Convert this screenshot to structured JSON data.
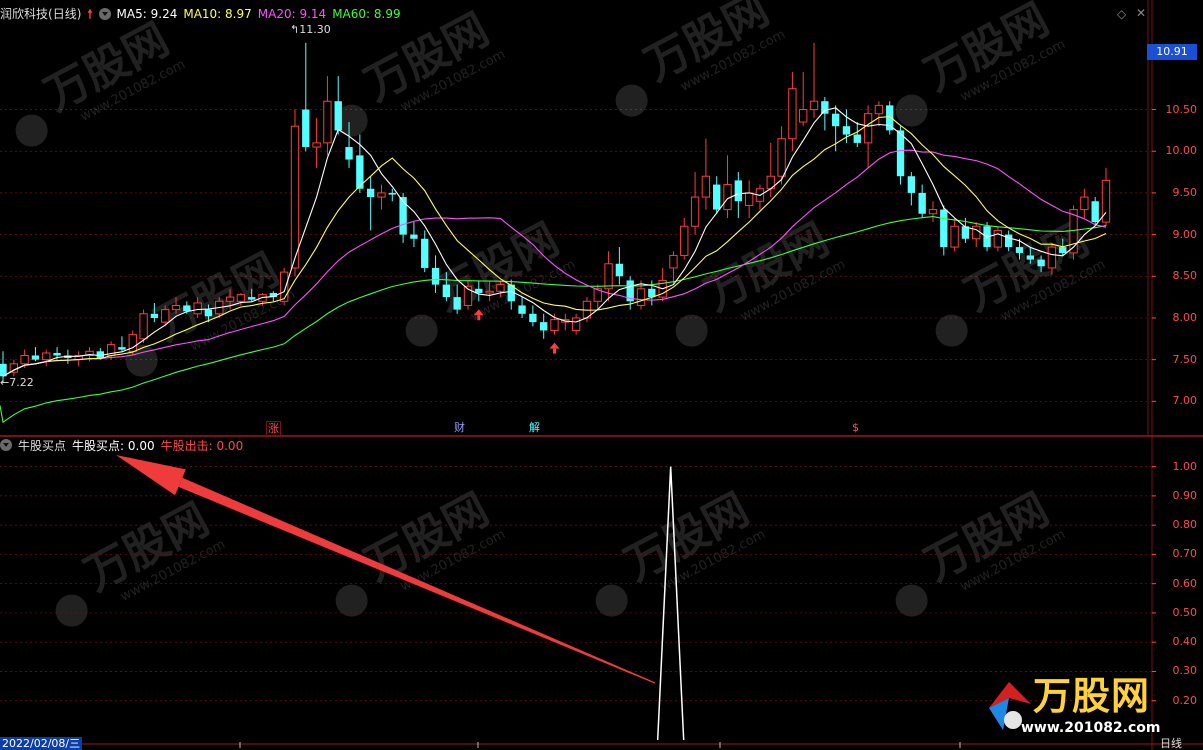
{
  "header": {
    "stock_name": "润欣科技",
    "period": "(日线)",
    "ma5_label": "MA5:",
    "ma5_value": "9.24",
    "ma10_label": "MA10:",
    "ma10_value": "8.97",
    "ma20_label": "MA20:",
    "ma20_value": "9.14",
    "ma60_label": "MA60:",
    "ma60_value": "8.99"
  },
  "colors": {
    "up": "#ff3b3b",
    "down": "#54ffff",
    "ma5": "#ffffff",
    "ma10": "#ffff4f",
    "ma20": "#ff4fff",
    "ma60": "#3cff3c",
    "grid": "#7a1010",
    "axis_text": "#ff4a4a"
  },
  "main_chart": {
    "high_label": "11.30",
    "low_label": "7.22",
    "current_price": "10.91",
    "y_ticks": [
      "10.50",
      "10.00",
      "9.50",
      "9.00",
      "8.50",
      "8.00",
      "7.50",
      "7.00"
    ],
    "events": [
      {
        "text": "涨",
        "color": "#ff5050"
      },
      {
        "text": "财",
        "color": "#9a9aff"
      },
      {
        "text": "解",
        "color": "#54ffff"
      },
      {
        "text": "$",
        "color": "#ff5050"
      }
    ]
  },
  "indicator": {
    "name": "牛股买点",
    "line1_label": "牛股买点:",
    "line1_value": "0.00",
    "line2_label": "牛股出击:",
    "line2_value": "0.00",
    "y_ticks": [
      "1.00",
      "0.90",
      "0.80",
      "0.70",
      "0.60",
      "0.50",
      "0.40",
      "0.30",
      "0.20"
    ]
  },
  "watermark": {
    "brand": "万股网",
    "url": "www.201082.com"
  },
  "footer": {
    "date_text": "2022/02/08/三",
    "period_tab": "日线"
  },
  "chart_data": [
    {
      "type": "candlestick",
      "y_range": [
        6.8,
        11.55
      ],
      "candles_ohlc": [
        [
          7.45,
          7.6,
          7.22,
          7.3
        ],
        [
          7.35,
          7.5,
          7.3,
          7.45
        ],
        [
          7.45,
          7.62,
          7.4,
          7.55
        ],
        [
          7.55,
          7.65,
          7.48,
          7.5
        ],
        [
          7.5,
          7.62,
          7.42,
          7.58
        ],
        [
          7.58,
          7.65,
          7.5,
          7.55
        ],
        [
          7.55,
          7.62,
          7.45,
          7.52
        ],
        [
          7.5,
          7.6,
          7.42,
          7.55
        ],
        [
          7.55,
          7.65,
          7.48,
          7.6
        ],
        [
          7.6,
          7.64,
          7.5,
          7.52
        ],
        [
          7.55,
          7.72,
          7.5,
          7.68
        ],
        [
          7.65,
          7.78,
          7.6,
          7.62
        ],
        [
          7.6,
          7.85,
          7.55,
          7.8
        ],
        [
          7.75,
          8.1,
          7.7,
          8.05
        ],
        [
          8.05,
          8.18,
          7.95,
          8.0
        ],
        [
          7.95,
          8.15,
          7.9,
          8.1
        ],
        [
          8.1,
          8.25,
          8.05,
          8.15
        ],
        [
          8.15,
          8.2,
          8.05,
          8.08
        ],
        [
          8.05,
          8.25,
          8.0,
          8.18
        ],
        [
          8.1,
          8.16,
          7.95,
          8.02
        ],
        [
          8.05,
          8.25,
          8.0,
          8.2
        ],
        [
          8.2,
          8.35,
          8.1,
          8.25
        ],
        [
          8.2,
          8.3,
          8.15,
          8.28
        ],
        [
          8.25,
          8.35,
          8.2,
          8.22
        ],
        [
          8.2,
          8.3,
          8.15,
          8.28
        ],
        [
          8.3,
          8.32,
          8.2,
          8.25
        ],
        [
          8.2,
          8.6,
          8.15,
          8.55
        ],
        [
          8.6,
          10.5,
          8.5,
          10.3
        ],
        [
          10.5,
          11.3,
          10.0,
          10.05
        ],
        [
          10.05,
          10.4,
          9.8,
          10.1
        ],
        [
          10.1,
          10.9,
          9.95,
          10.6
        ],
        [
          10.6,
          10.9,
          10.2,
          10.25
        ],
        [
          10.05,
          10.35,
          9.8,
          9.9
        ],
        [
          9.95,
          10.2,
          9.5,
          9.55
        ],
        [
          9.55,
          9.7,
          9.05,
          9.45
        ],
        [
          9.45,
          9.6,
          9.3,
          9.5
        ],
        [
          9.5,
          9.55,
          9.4,
          9.48
        ],
        [
          9.45,
          9.5,
          8.9,
          9.0
        ],
        [
          9.0,
          9.15,
          8.85,
          8.95
        ],
        [
          8.95,
          9.05,
          8.55,
          8.6
        ],
        [
          8.6,
          8.75,
          8.3,
          8.4
        ],
        [
          8.4,
          8.55,
          8.2,
          8.25
        ],
        [
          8.25,
          8.4,
          8.05,
          8.1
        ],
        [
          8.15,
          8.45,
          8.1,
          8.38
        ],
        [
          8.35,
          8.45,
          8.2,
          8.3
        ],
        [
          8.3,
          8.45,
          8.2,
          8.32
        ],
        [
          8.32,
          8.45,
          8.25,
          8.4
        ],
        [
          8.4,
          8.46,
          8.1,
          8.2
        ],
        [
          8.15,
          8.25,
          8.0,
          8.05
        ],
        [
          8.05,
          8.15,
          7.9,
          7.95
        ],
        [
          7.95,
          8.05,
          7.75,
          7.85
        ],
        [
          7.85,
          8.05,
          7.8,
          7.98
        ],
        [
          7.95,
          8.05,
          7.85,
          7.98
        ],
        [
          7.85,
          8.05,
          7.8,
          8.0
        ],
        [
          8.0,
          8.25,
          7.95,
          8.2
        ],
        [
          8.2,
          8.4,
          8.1,
          8.35
        ],
        [
          8.35,
          8.8,
          8.2,
          8.65
        ],
        [
          8.65,
          8.85,
          8.4,
          8.5
        ],
        [
          8.45,
          8.5,
          8.1,
          8.2
        ],
        [
          8.15,
          8.45,
          8.1,
          8.35
        ],
        [
          8.35,
          8.45,
          8.15,
          8.25
        ],
        [
          8.25,
          8.6,
          8.2,
          8.45
        ],
        [
          8.6,
          8.8,
          8.4,
          8.75
        ],
        [
          8.75,
          9.2,
          8.7,
          9.1
        ],
        [
          9.1,
          9.75,
          9.0,
          9.45
        ],
        [
          9.45,
          10.15,
          9.3,
          9.7
        ],
        [
          9.6,
          9.7,
          9.25,
          9.3
        ],
        [
          9.3,
          9.95,
          9.2,
          9.6
        ],
        [
          9.65,
          9.75,
          9.2,
          9.4
        ],
        [
          9.35,
          9.65,
          9.2,
          9.5
        ],
        [
          9.4,
          9.6,
          9.3,
          9.55
        ],
        [
          9.55,
          10.1,
          9.45,
          9.7
        ],
        [
          9.7,
          10.3,
          9.6,
          10.15
        ],
        [
          10.15,
          10.95,
          10.0,
          10.75
        ],
        [
          10.35,
          10.95,
          10.3,
          10.5
        ],
        [
          10.5,
          11.3,
          10.4,
          10.6
        ],
        [
          10.6,
          10.65,
          10.25,
          10.45
        ],
        [
          10.45,
          10.55,
          10.0,
          10.3
        ],
        [
          10.3,
          10.5,
          10.1,
          10.2
        ],
        [
          10.2,
          10.35,
          10.05,
          10.1
        ],
        [
          10.1,
          10.55,
          9.8,
          10.45
        ],
        [
          10.45,
          10.6,
          10.3,
          10.55
        ],
        [
          10.55,
          10.6,
          10.2,
          10.25
        ],
        [
          10.25,
          10.3,
          9.6,
          9.7
        ],
        [
          9.7,
          9.75,
          9.35,
          9.5
        ],
        [
          9.5,
          9.6,
          9.2,
          9.25
        ],
        [
          9.25,
          9.4,
          9.15,
          9.3
        ],
        [
          9.3,
          9.35,
          8.75,
          8.85
        ],
        [
          8.85,
          9.2,
          8.8,
          9.1
        ],
        [
          9.1,
          9.2,
          8.9,
          8.95
        ],
        [
          8.95,
          9.15,
          8.85,
          9.1
        ],
        [
          9.1,
          9.15,
          8.8,
          8.85
        ],
        [
          8.85,
          9.1,
          8.8,
          9.05
        ],
        [
          9.0,
          9.05,
          8.8,
          8.85
        ],
        [
          8.85,
          8.95,
          8.7,
          8.78
        ],
        [
          8.75,
          8.85,
          8.65,
          8.7
        ],
        [
          8.7,
          8.75,
          8.55,
          8.62
        ],
        [
          8.6,
          8.9,
          8.52,
          8.85
        ],
        [
          8.85,
          8.95,
          8.75,
          8.78
        ],
        [
          8.78,
          9.35,
          8.7,
          9.3
        ],
        [
          9.3,
          9.55,
          9.2,
          9.45
        ],
        [
          9.4,
          9.45,
          9.1,
          9.15
        ],
        [
          9.15,
          9.8,
          9.1,
          9.65
        ]
      ],
      "buy_arrows_at_candle": [
        44,
        51
      ]
    },
    {
      "type": "line",
      "series": [
        {
          "name": "牛股买点",
          "peak_value": 1.0,
          "peak_at_fraction": 0.56
        }
      ],
      "ylim": [
        0.1,
        1.05
      ]
    }
  ]
}
